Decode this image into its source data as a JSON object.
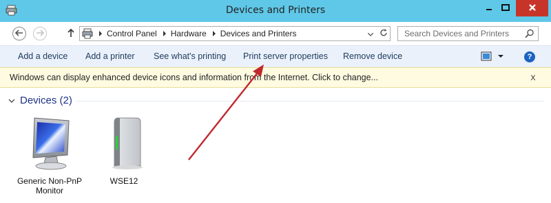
{
  "window": {
    "title": "Devices and Printers",
    "app_icon": "devices-printers-icon",
    "controls": [
      "minimize-icon",
      "maximize-icon",
      "close-icon"
    ],
    "close_color": "#c7352a",
    "titlebar_color": "#5fc8e8"
  },
  "nav": {
    "back_icon": "back-arrow-icon",
    "forward_icon": "forward-arrow-icon",
    "up_icon": "up-arrow-icon"
  },
  "address": {
    "breadcrumbs": [
      "Control Panel",
      "Hardware",
      "Devices and Printers"
    ],
    "refresh_icon": "refresh-icon"
  },
  "search": {
    "placeholder": "Search Devices and Printers",
    "icon": "search-icon"
  },
  "commands": {
    "add_device": "Add a device",
    "add_printer": "Add a printer",
    "see_printing": "See what's printing",
    "print_server": "Print server properties",
    "remove_device": "Remove device",
    "view_icon": "view-options-icon",
    "help_icon": "help-icon"
  },
  "infobar": {
    "message": "Windows can display enhanced device icons and information from the Internet. Click to change...",
    "close": "x"
  },
  "devices_group": {
    "title": "Devices (2)",
    "items": [
      {
        "label_line1": "Generic Non-PnP",
        "label_line2": "Monitor",
        "icon": "monitor-icon"
      },
      {
        "label_line1": "WSE12",
        "icon": "server-icon"
      }
    ]
  },
  "colors": {
    "command_bar_bg": "#eaf1fb",
    "infobar_bg": "#fffbe1",
    "group_title": "#1e3287",
    "annotation_arrow": "#c0282d"
  }
}
